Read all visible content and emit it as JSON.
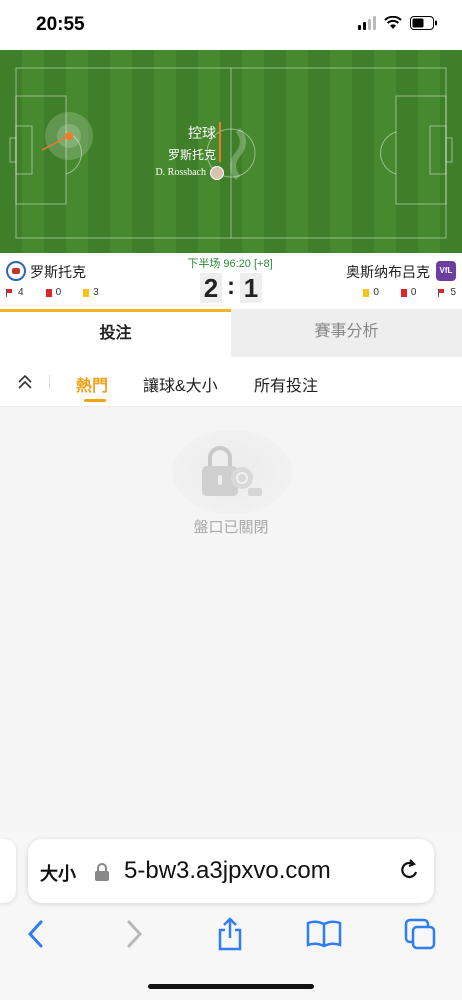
{
  "status_bar": {
    "time": "20:55"
  },
  "pitch": {
    "control_label": "控球",
    "control_team": "罗斯托克",
    "player_name": "D. Rossbach"
  },
  "match": {
    "period": "下半场 96:20 [+8]",
    "home": {
      "name": "罗斯托克",
      "corners": "4",
      "red_cards": "0",
      "yellow_cards": "3",
      "score": "2"
    },
    "away": {
      "name": "奥斯纳布吕克",
      "crest_text": "VfL",
      "corners": "5",
      "red_cards": "0",
      "yellow_cards": "0",
      "score": "1"
    },
    "separator": ":"
  },
  "main_tabs": {
    "bet": "投注",
    "analysis": "賽事分析"
  },
  "sub_tabs": {
    "hot": "熱門",
    "handicap": "讓球&大小",
    "all": "所有投注"
  },
  "empty_state": {
    "message": "盤口已關閉"
  },
  "browser": {
    "text_size": "大小",
    "url": "5-bw3.a3jpxvo.com"
  },
  "colors": {
    "accent": "#f0a21b",
    "pitch": "#44852d",
    "period_green": "#2a8a3a",
    "link_blue": "#2f7cf6"
  }
}
